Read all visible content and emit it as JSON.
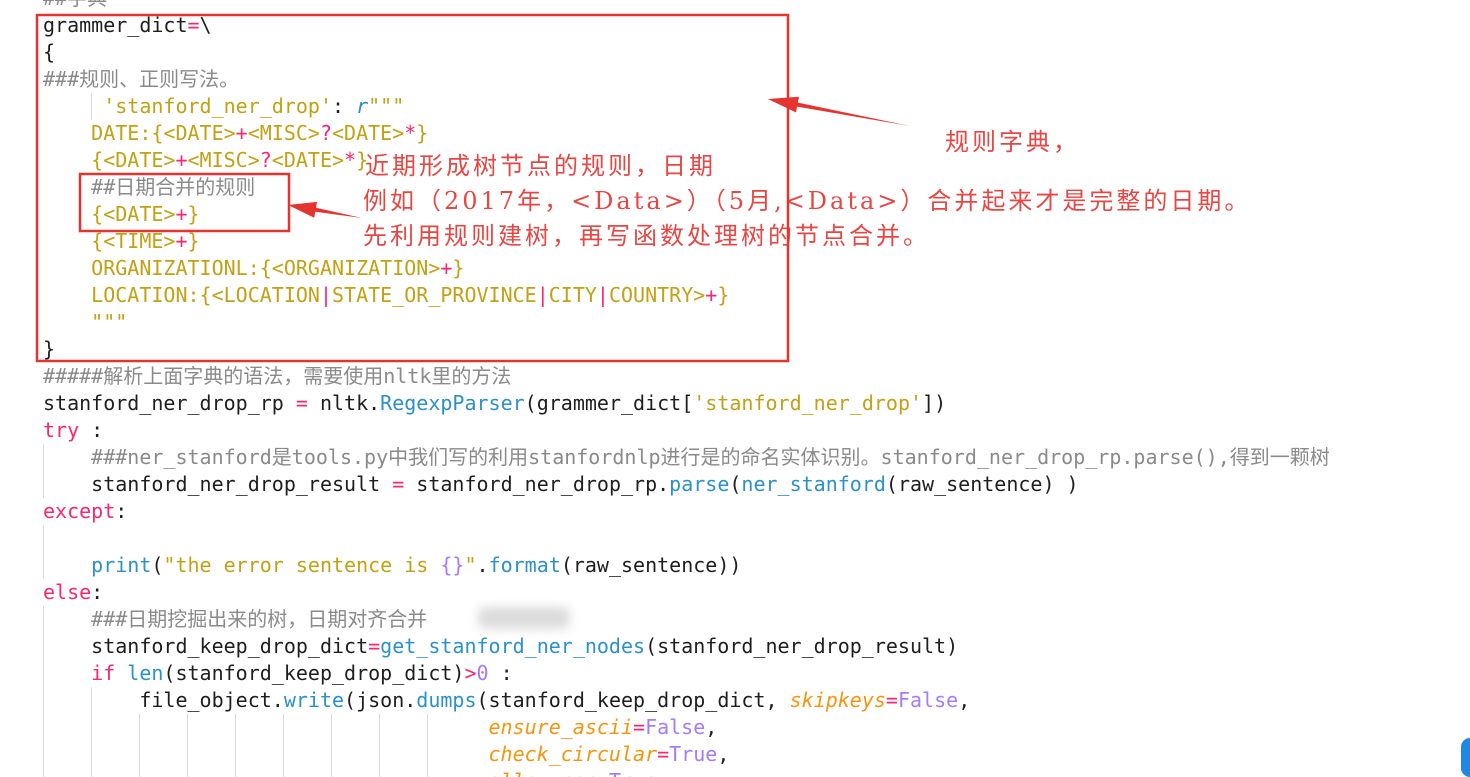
{
  "theme": {
    "bg": "#ffffff",
    "plain": "#1e1e1e",
    "comment": "#8a8a8a",
    "string": "#c2a114",
    "kw": "#f92672",
    "op": "#f92672",
    "func": "#2b91c9",
    "param": "#f5950f",
    "const": "#a47bff",
    "annot": "#e5332f",
    "fab": "#1e88e5"
  },
  "editor": {
    "lines": [
      [
        [
          "comment",
          "##字典"
        ]
      ],
      [
        [
          "plain",
          "grammer_dict"
        ],
        [
          "op",
          "="
        ],
        [
          "plain",
          "\\"
        ]
      ],
      [
        [
          "plain",
          "{"
        ]
      ],
      [
        [
          "comment",
          "###规则、正则写法。"
        ]
      ],
      [
        [
          "string",
          "     'stanford_ner_drop'"
        ],
        [
          "plain",
          ": "
        ],
        [
          "prefix",
          "r"
        ],
        [
          "string",
          "\"\"\""
        ]
      ],
      [
        [
          "string",
          "    DATE:{<DATE>"
        ],
        [
          "op",
          "+"
        ],
        [
          "string",
          "<MISC>"
        ],
        [
          "op",
          "?"
        ],
        [
          "string",
          "<DATE>"
        ],
        [
          "op",
          "*"
        ],
        [
          "string",
          "}"
        ]
      ],
      [
        [
          "string",
          "    {<DATE>"
        ],
        [
          "op",
          "+"
        ],
        [
          "string",
          "<MISC>"
        ],
        [
          "op",
          "?"
        ],
        [
          "string",
          "<DATE>"
        ],
        [
          "op",
          "*"
        ],
        [
          "string",
          "}"
        ]
      ],
      [
        [
          "comment",
          "    ##日期合并的规则"
        ]
      ],
      [
        [
          "string",
          "    {<DATE>"
        ],
        [
          "op",
          "+"
        ],
        [
          "string",
          "}"
        ]
      ],
      [
        [
          "string",
          "    {<TIME>"
        ],
        [
          "op",
          "+"
        ],
        [
          "string",
          "}"
        ]
      ],
      [
        [
          "string",
          "    ORGANIZATIONL:{<ORGANIZATION>"
        ],
        [
          "op",
          "+"
        ],
        [
          "string",
          "}"
        ]
      ],
      [
        [
          "string",
          "    LOCATION:{<LOCATION"
        ],
        [
          "op",
          "|"
        ],
        [
          "string",
          "STATE_OR_PROVINCE"
        ],
        [
          "op",
          "|"
        ],
        [
          "string",
          "CITY"
        ],
        [
          "op",
          "|"
        ],
        [
          "string",
          "COUNTRY>"
        ],
        [
          "op",
          "+"
        ],
        [
          "string",
          "}"
        ]
      ],
      [
        [
          "string",
          "    \"\"\""
        ]
      ],
      [
        [
          "plain",
          "}"
        ]
      ],
      [
        [
          "comment",
          "#####解析上面字典的语法，需要使用nltk里的方法"
        ]
      ],
      [
        [
          "plain",
          "stanford_ner_drop_rp "
        ],
        [
          "op",
          "="
        ],
        [
          "plain",
          " nltk."
        ],
        [
          "func",
          "RegexpParser"
        ],
        [
          "plain",
          "(grammer_dict["
        ],
        [
          "string",
          "'stanford_ner_drop'"
        ],
        [
          "plain",
          "])"
        ]
      ],
      [
        [
          "kw",
          "try"
        ],
        [
          "plain",
          " :"
        ]
      ],
      [
        [
          "comment",
          "    ###ner_stanford是tools.py中我们写的利用stanfordnlp进行是的命名实体识别。stanford_ner_drop_rp.parse(),得到一颗树"
        ]
      ],
      [
        [
          "plain",
          "    stanford_ner_drop_result "
        ],
        [
          "op",
          "="
        ],
        [
          "plain",
          " stanford_ner_drop_rp."
        ],
        [
          "func",
          "parse"
        ],
        [
          "plain",
          "("
        ],
        [
          "func",
          "ner_stanford"
        ],
        [
          "plain",
          "(raw_sentence) )"
        ]
      ],
      [
        [
          "kw",
          "except"
        ],
        [
          "plain",
          ":"
        ]
      ],
      [],
      [
        [
          "func",
          "    print"
        ],
        [
          "plain",
          "("
        ],
        [
          "string",
          "\"the error sentence is "
        ],
        [
          "const",
          "{}"
        ],
        [
          "string",
          "\""
        ],
        [
          "plain",
          "."
        ],
        [
          "func",
          "format"
        ],
        [
          "plain",
          "(raw_sentence))"
        ]
      ],
      [
        [
          "kw",
          "else"
        ],
        [
          "plain",
          ":"
        ]
      ],
      [
        [
          "comment",
          "    ###日期挖掘出来的树，日期对齐合并"
        ]
      ],
      [
        [
          "plain",
          "    stanford_keep_drop_dict"
        ],
        [
          "op",
          "="
        ],
        [
          "func",
          "get_stanford_ner_nodes"
        ],
        [
          "plain",
          "(stanford_ner_drop_result)"
        ]
      ],
      [
        [
          "kw",
          "    if"
        ],
        [
          "func",
          " len"
        ],
        [
          "plain",
          "(stanford_keep_drop_dict)"
        ],
        [
          "op",
          ">"
        ],
        [
          "const",
          "0"
        ],
        [
          "plain",
          " :"
        ]
      ],
      [
        [
          "plain",
          "        file_object."
        ],
        [
          "func",
          "write"
        ],
        [
          "plain",
          "(json."
        ],
        [
          "func",
          "dumps"
        ],
        [
          "plain",
          "(stanford_keep_drop_dict, "
        ],
        [
          "param",
          "skipkeys"
        ],
        [
          "op",
          "="
        ],
        [
          "const",
          "False"
        ],
        [
          "plain",
          ","
        ]
      ],
      [
        [
          "param",
          "                                     ensure_ascii"
        ],
        [
          "op",
          "="
        ],
        [
          "const",
          "False"
        ],
        [
          "plain",
          ","
        ]
      ],
      [
        [
          "param",
          "                                     check_circular"
        ],
        [
          "op",
          "="
        ],
        [
          "const",
          "True"
        ],
        [
          "plain",
          ","
        ]
      ],
      [
        [
          "param",
          "                                     allow_nan"
        ],
        [
          "op",
          "="
        ],
        [
          "const",
          "True"
        ],
        [
          "plain",
          ","
        ]
      ]
    ]
  },
  "annotations": {
    "dict_label": "规则字典，",
    "notes": [
      "近期形成树节点的规则，日期",
      "例如（2017年，<Data>）（5月,<Data>）合并起来才是完整的日期。",
      "先利用规则建树，再写函数处理树的节点合并。"
    ]
  }
}
